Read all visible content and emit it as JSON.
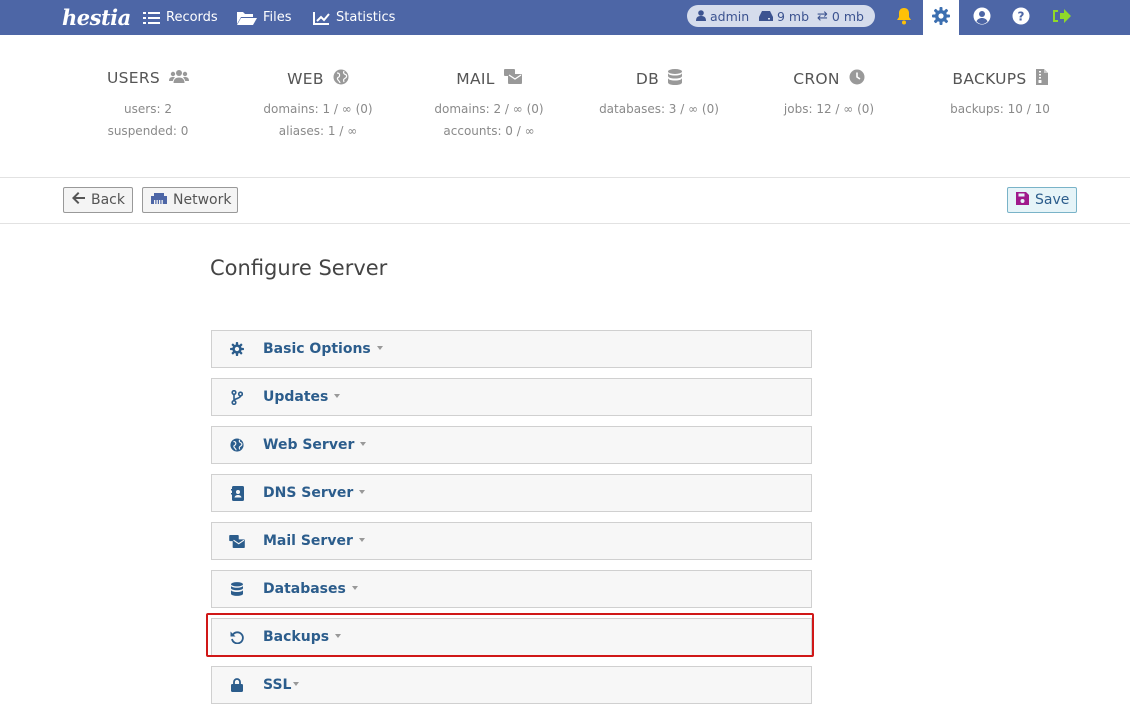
{
  "topbar": {
    "logo_text": "hestia",
    "nav": [
      {
        "label": "Records",
        "icon": "list-icon"
      },
      {
        "label": "Files",
        "icon": "folder-open-icon"
      },
      {
        "label": "Statistics",
        "icon": "chart-line-icon"
      }
    ],
    "usage": {
      "user": "admin",
      "disk": "9 mb",
      "bandwidth": "0 mb"
    },
    "icons": [
      "bell-icon",
      "gear-icon",
      "user-circle-icon",
      "help-icon",
      "logout-icon"
    ]
  },
  "stats": [
    {
      "title": "USERS",
      "icon": "users-icon",
      "lines": [
        "users: 2",
        "suspended: 0"
      ]
    },
    {
      "title": "WEB",
      "icon": "globe-icon",
      "lines": [
        "domains: 1 / ∞ (0)",
        "aliases: 1 / ∞"
      ]
    },
    {
      "title": "MAIL",
      "icon": "mail-bulk-icon",
      "lines": [
        "domains: 2 / ∞ (0)",
        "accounts: 0 / ∞"
      ]
    },
    {
      "title": "DB",
      "icon": "database-icon",
      "lines": [
        "databases: 3 / ∞ (0)"
      ]
    },
    {
      "title": "CRON",
      "icon": "clock-icon",
      "lines": [
        "jobs: 12 / ∞ (0)"
      ]
    },
    {
      "title": "BACKUPS",
      "icon": "file-archive-icon",
      "lines": [
        "backups: 10 / 10"
      ]
    }
  ],
  "toolbar": {
    "back_label": "Back",
    "network_label": "Network",
    "save_label": "Save"
  },
  "main": {
    "title": "Configure Server",
    "sections": [
      {
        "label": "Basic Options",
        "icon": "cog-icon"
      },
      {
        "label": "Updates",
        "icon": "code-branch-icon"
      },
      {
        "label": "Web Server",
        "icon": "globe-icon"
      },
      {
        "label": "DNS Server",
        "icon": "address-book-icon"
      },
      {
        "label": "Mail Server",
        "icon": "mail-bulk-icon"
      },
      {
        "label": "Databases",
        "icon": "database-icon"
      },
      {
        "label": "Backups",
        "icon": "undo-icon"
      },
      {
        "label": "SSL",
        "icon": "lock-icon"
      }
    ]
  },
  "colors": {
    "topbar": "#4d66a6",
    "link": "#2c5d8c",
    "highlight": "#d01818",
    "bell": "#ffc107",
    "logout": "#8fd92a"
  }
}
